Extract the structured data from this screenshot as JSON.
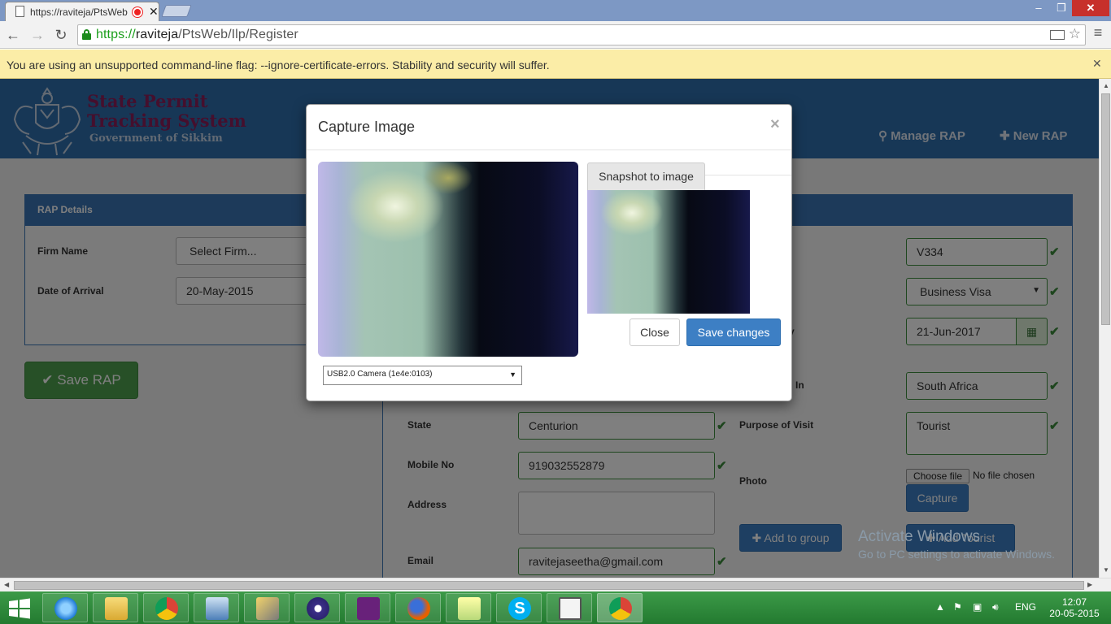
{
  "browser": {
    "tab_title": "https://raviteja/PtsWeb",
    "url_scheme": "https://",
    "url_host": "raviteja",
    "url_path": "/PtsWeb/Ilp/Register",
    "infobar": "You are using an unsupported command-line flag: --ignore-certificate-errors. Stability and security will suffer."
  },
  "header": {
    "brand_line1": "State Permit",
    "brand_line2": "Tracking System",
    "brand_sub": "Government of Sikkim",
    "nav": [
      "Manage RAP",
      "New RAP"
    ]
  },
  "rap_details": {
    "title": "RAP Details",
    "firm_label": "Firm Name",
    "firm_value": "Select Firm...",
    "arrival_label": "Date of Arrival",
    "arrival_value": "20-May-2015",
    "save_label": "Save RAP"
  },
  "tourist": {
    "visa_no_label_fragment": "er",
    "visa_no": "V334",
    "visa_type": "Business Visa",
    "visa_expiry_label_fragment": "y",
    "visa_expiry": "21-Jun-2017",
    "residing_label_fragment": "In",
    "residing_in": "South Africa",
    "state_label": "State",
    "state": "Centurion",
    "purpose_label": "Purpose of Visit",
    "purpose": "Tourist",
    "mobile_label": "Mobile No",
    "mobile": "919032552879",
    "photo_label": "Photo",
    "choose_file": "Choose file",
    "no_file": "No file chosen",
    "capture_label": "Capture",
    "address_label": "Address",
    "address": "",
    "add_group_label": "Add to group",
    "add_tourist_label": "Add Tourist",
    "email_label": "Email",
    "email": "ravitejaseetha@gmail.com"
  },
  "modal": {
    "title": "Capture Image",
    "close_x": "×",
    "snapshot_label": "Snapshot to image",
    "close_label": "Close",
    "save_label": "Save changes",
    "camera_option": "USB2.0 Camera (1e4e:0103)"
  },
  "watermark": {
    "line1": "Activate Windows",
    "line2": "Go to PC settings to activate Windows."
  },
  "taskbar": {
    "lang": "ENG",
    "time": "12:07",
    "date": "20-05-2015",
    "apps": [
      "ie-icon",
      "file-explorer-icon",
      "chrome-icon",
      "server-manager-icon",
      "tools-icon",
      "eclipse-icon",
      "visual-studio-icon",
      "firefox-icon",
      "notes-icon",
      "skype-icon",
      "document-icon",
      "chrome-icon"
    ]
  },
  "colors": {
    "header": "#2f6fad",
    "brand": "#8b1f5a",
    "success": "#4fa04f",
    "primary": "#3d7fc4",
    "taskbar": "#2b8a3a"
  }
}
